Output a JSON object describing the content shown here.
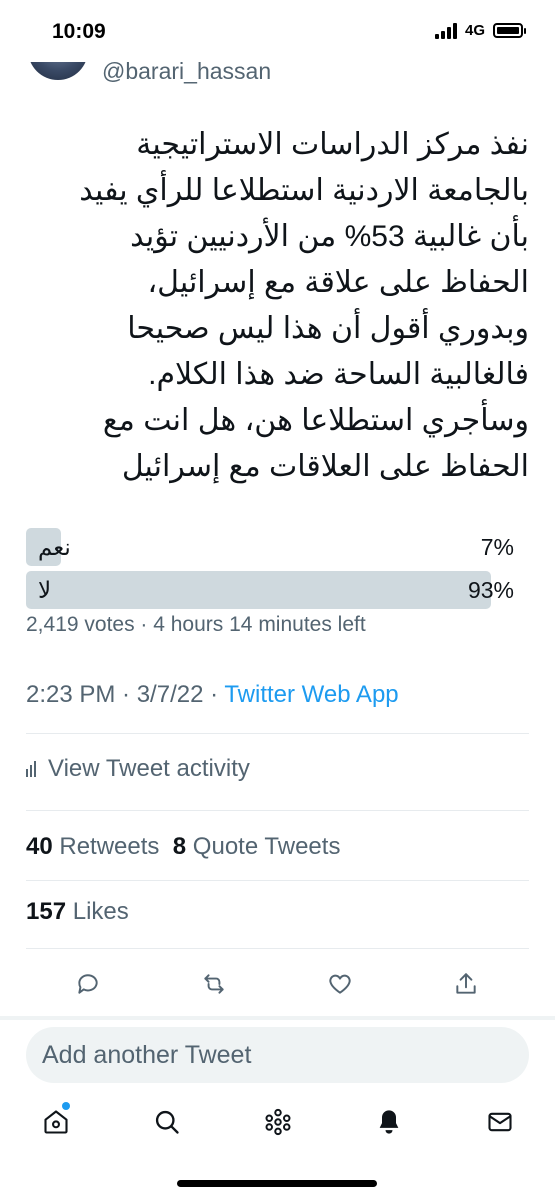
{
  "status_bar": {
    "time": "10:09",
    "network": "4G"
  },
  "author": {
    "handle": "@barari_hassan"
  },
  "tweet": {
    "text_lines": [
      "نفذ مركز الدراسات الاستراتيجية",
      "بالجامعة الاردنية استطلاعا للرأي يفيد",
      "بأن غالبية 53% من الأردنيين تؤيد",
      "الحفاظ على علاقة مع إسرائيل،",
      "وبدوري أقول أن هذا ليس صحيحا",
      "فالغالبية الساحة ضد هذا الكلام.",
      "وسأجري استطلاعا هن، هل انت مع",
      "الحفاظ على العلاقات مع إسرائيل"
    ]
  },
  "poll": {
    "options": [
      {
        "label": "نعم",
        "percent_text": "7%",
        "fraction": 0.07
      },
      {
        "label": "لا",
        "percent_text": "93%",
        "fraction": 0.93
      }
    ],
    "meta": "2,419 votes · 4 hours 14 minutes left"
  },
  "timestamp": {
    "time_date": "2:23 PM · 3/7/22 · ",
    "via": "Twitter Web App"
  },
  "activity": {
    "label": "View Tweet activity"
  },
  "stats": {
    "retweets_count": "40",
    "retweets_label": "Retweets",
    "quotes_count": "8",
    "quotes_label": "Quote Tweets",
    "likes_count": "157",
    "likes_label": "Likes"
  },
  "actions": [
    "reply-icon",
    "retweet-icon",
    "like-icon",
    "share-icon"
  ],
  "reply": {
    "placeholder": "Add another Tweet"
  },
  "tabbar": [
    "home-icon",
    "search-icon",
    "spaces-icon",
    "notifications-icon",
    "messages-icon"
  ],
  "colors": {
    "accent": "#1d9bf0",
    "secondary_text": "#536471",
    "poll_bar": "#cfd9de"
  }
}
